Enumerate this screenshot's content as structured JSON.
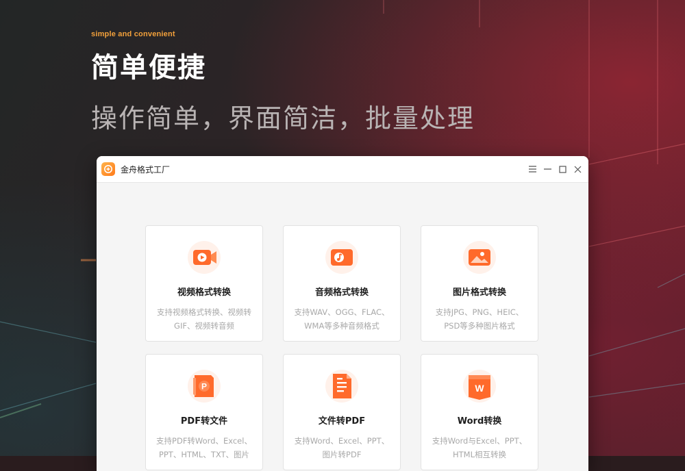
{
  "hero": {
    "tagline": "simple and convenient",
    "headline": "简单便捷",
    "subheadline": "操作简单，界面简洁，批量处理"
  },
  "window": {
    "app_title": "金舟格式工厂",
    "controls": {
      "menu_icon": "menu-icon",
      "minimize_icon": "minimize-icon",
      "maximize_icon": "maximize-icon",
      "close_icon": "close-icon"
    }
  },
  "cards": [
    {
      "title": "视频格式转换",
      "desc": "支持视频格式转换、视频转GIF、视频转音频",
      "icon": "video-convert-icon"
    },
    {
      "title": "音频格式转换",
      "desc": "支持WAV、OGG、FLAC、WMA等多种音频格式",
      "icon": "audio-convert-icon"
    },
    {
      "title": "图片格式转换",
      "desc": "支持JPG、PNG、HEIC、PSD等多种图片格式",
      "icon": "image-convert-icon"
    },
    {
      "title": "PDF转文件",
      "desc": "支持PDF转Word、Excel、PPT、HTML、TXT、图片",
      "icon": "pdf-to-file-icon"
    },
    {
      "title": "文件转PDF",
      "desc": "支持Word、Excel、PPT、图片转PDF",
      "icon": "file-to-pdf-icon"
    },
    {
      "title": "Word转换",
      "desc": "支持Word与Excel、PPT、HTML相互转换",
      "icon": "word-convert-icon"
    }
  ],
  "colors": {
    "accent": "#ff6a2b",
    "tagline": "#f3a13b",
    "icon_glow": "#ffd9c9"
  }
}
